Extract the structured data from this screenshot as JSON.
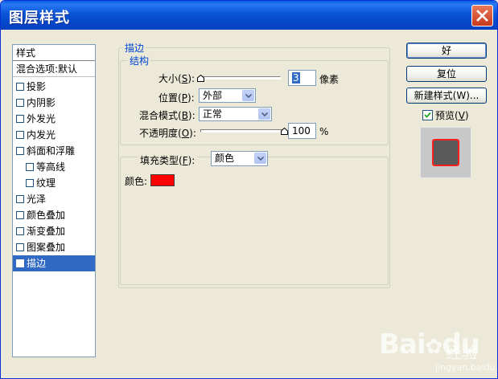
{
  "window": {
    "title": "图层样式"
  },
  "style_list": {
    "items": [
      {
        "label": "样式",
        "checkbox": false,
        "checked": false,
        "indent": false,
        "type": "header"
      },
      {
        "label": "混合选项:默认",
        "checkbox": false,
        "checked": false,
        "indent": false,
        "type": "sep"
      },
      {
        "label": "投影",
        "checkbox": true,
        "checked": false,
        "indent": false
      },
      {
        "label": "内阴影",
        "checkbox": true,
        "checked": false,
        "indent": false
      },
      {
        "label": "外发光",
        "checkbox": true,
        "checked": false,
        "indent": false
      },
      {
        "label": "内发光",
        "checkbox": true,
        "checked": false,
        "indent": false
      },
      {
        "label": "斜面和浮雕",
        "checkbox": true,
        "checked": false,
        "indent": false
      },
      {
        "label": "等高线",
        "checkbox": true,
        "checked": false,
        "indent": true
      },
      {
        "label": "纹理",
        "checkbox": true,
        "checked": false,
        "indent": true
      },
      {
        "label": "光泽",
        "checkbox": true,
        "checked": false,
        "indent": false
      },
      {
        "label": "颜色叠加",
        "checkbox": true,
        "checked": false,
        "indent": false
      },
      {
        "label": "渐变叠加",
        "checkbox": true,
        "checked": false,
        "indent": false
      },
      {
        "label": "图案叠加",
        "checkbox": true,
        "checked": false,
        "indent": false
      },
      {
        "label": "描边",
        "checkbox": true,
        "checked": true,
        "indent": false,
        "selected": true
      }
    ]
  },
  "stroke": {
    "group_title": "描边",
    "structure_title": "结构",
    "size_label": "大小(",
    "size_key": "S",
    "size_label_end": "):",
    "size_value": "3",
    "size_unit": "像素",
    "size_level": 0.0,
    "position_label": "位置(",
    "position_key": "P",
    "position_label_end": "):",
    "position_value": "外部",
    "blend_label": "混合模式(",
    "blend_key": "B",
    "blend_label_end": "):",
    "blend_value": "正常",
    "opacity_label": "不透明度(",
    "opacity_key": "O",
    "opacity_label_end": "):",
    "opacity_value": "100",
    "opacity_unit": "%",
    "opacity_level": 1.0,
    "fill_type_label": "填充类型(",
    "fill_type_key": "F",
    "fill_type_label_end": "):",
    "fill_type_value": "颜色",
    "color_label": "颜色:",
    "color_value": "#FF0000"
  },
  "buttons": {
    "ok": "好",
    "reset": "复位",
    "new_style": "新建样式(W)...",
    "preview_label": "预览(",
    "preview_key": "V",
    "preview_label_end": ")",
    "preview_checked": true
  },
  "watermark": {
    "text": "Bai",
    "paw": "du",
    "sub": "经验",
    "url": "jingyan.baidu.com"
  }
}
